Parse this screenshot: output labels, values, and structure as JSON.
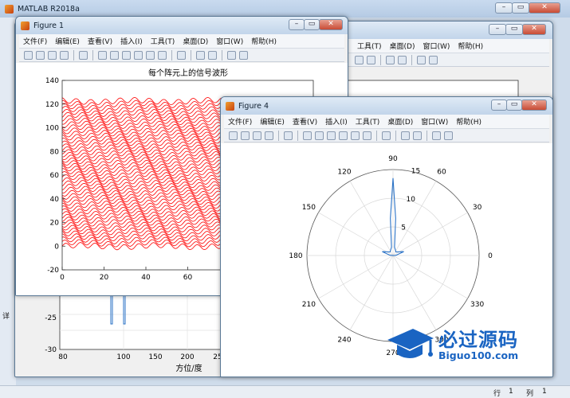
{
  "main_window": {
    "title": "MATLAB R2018a"
  },
  "menu_items": [
    "文件(F)",
    "编辑(E)",
    "查看(V)",
    "插入(I)",
    "工具(T)",
    "桌面(D)",
    "窗口(W)",
    "帮助(H)"
  ],
  "window_controls": {
    "minimize": "–",
    "maximize": "▭",
    "close": "✕"
  },
  "background_menu_partial": [
    "工具(T)",
    "桌面(D)",
    "窗口(W)",
    "帮助(H)"
  ],
  "behind_figure": {
    "y_ticks": [
      "-25",
      "-30"
    ],
    "x_ticks": [
      "80",
      "100",
      "150",
      "200",
      "25"
    ],
    "xlabel": "方位/度",
    "side_label": "详"
  },
  "status_bar": {
    "row_label": "行",
    "row_value": "1",
    "col_label": "列",
    "col_value": "1"
  },
  "figure1": {
    "title": "Figure 1",
    "plot_title": "每个阵元上的信号波形",
    "y_ticks": [
      "140",
      "120",
      "100",
      "80",
      "60",
      "40",
      "20",
      "0",
      "-20"
    ],
    "x_ticks": [
      "0",
      "20",
      "40",
      "60"
    ],
    "line_color": "#ff0000"
  },
  "figure4": {
    "title": "Figure 4",
    "angle_labels": [
      "90",
      "60",
      "30",
      "0",
      "330",
      "300",
      "270",
      "240",
      "210",
      "180",
      "150",
      "120"
    ],
    "radial_labels": [
      "15",
      "10",
      "5"
    ],
    "line_color": "#2a72c6"
  },
  "watermark": {
    "chinese": "必过源码",
    "site": "Biguo100.com"
  },
  "chart_data": [
    {
      "type": "line",
      "title": "每个阵元上的信号波形",
      "xlabel": "",
      "ylabel": "",
      "xlim": [
        0,
        120
      ],
      "ylim": [
        -20,
        140
      ],
      "grid": false,
      "description_series": "many stacked sinusoidal signals, offsets 0 to 125",
      "series_count": 50,
      "offset_step": 2.5,
      "amplitude": 2.2
    },
    {
      "type": "line",
      "subtype": "polar",
      "rlim": [
        0,
        15
      ],
      "r_ticks": [
        5,
        10,
        15
      ],
      "theta_ticks_deg": [
        0,
        30,
        60,
        90,
        120,
        150,
        180,
        210,
        240,
        270,
        300,
        330
      ],
      "points": [
        {
          "theta": 90,
          "r": 13.5
        },
        {
          "theta": 86,
          "r": 6.5
        },
        {
          "theta": 80,
          "r": 1.5
        },
        {
          "theta": 50,
          "r": 0.8
        },
        {
          "theta": 20,
          "r": 2.0
        },
        {
          "theta": 5,
          "r": 0.5
        },
        {
          "theta": 0,
          "r": 0.2
        },
        {
          "theta": 175,
          "r": 0.5
        },
        {
          "theta": 160,
          "r": 2.0
        },
        {
          "theta": 130,
          "r": 0.8
        },
        {
          "theta": 100,
          "r": 1.5
        },
        {
          "theta": 94,
          "r": 6.5
        },
        {
          "theta": 90,
          "r": 13.5
        }
      ]
    }
  ]
}
